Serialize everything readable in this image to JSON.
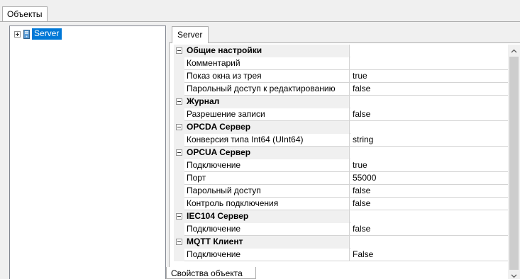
{
  "top_tab": {
    "label": "Объекты"
  },
  "tree": {
    "items": [
      {
        "label": "Server",
        "icon": "server-icon"
      }
    ]
  },
  "inner_tab": {
    "label": "Server"
  },
  "bottom_tab": {
    "label": "Свойства объекта"
  },
  "grid": {
    "rows": [
      {
        "type": "category",
        "name": "Общие настройки",
        "value": ""
      },
      {
        "type": "property",
        "name": "Комментарий",
        "value": ""
      },
      {
        "type": "property",
        "name": "Показ окна из трея",
        "value": "true"
      },
      {
        "type": "property",
        "name": "Парольный доступ к редактированию",
        "value": "false"
      },
      {
        "type": "category",
        "name": "Журнал",
        "value": ""
      },
      {
        "type": "property",
        "name": "Разрешение записи",
        "value": "false"
      },
      {
        "type": "category",
        "name": "OPCDA Сервер",
        "value": ""
      },
      {
        "type": "property",
        "name": "Конверсия типа Int64 (UInt64)",
        "value": "string"
      },
      {
        "type": "category",
        "name": "OPCUA Сервер",
        "value": ""
      },
      {
        "type": "property",
        "name": "Подключение",
        "value": "true"
      },
      {
        "type": "property",
        "name": "Порт",
        "value": "55000"
      },
      {
        "type": "property",
        "name": "Парольный доступ",
        "value": "false"
      },
      {
        "type": "property",
        "name": "Контроль подключения",
        "value": "false"
      },
      {
        "type": "category",
        "name": "IEC104 Сервер",
        "value": ""
      },
      {
        "type": "property",
        "name": "Подключение",
        "value": "false"
      },
      {
        "type": "category",
        "name": "MQTT Клиент",
        "value": ""
      },
      {
        "type": "property",
        "name": "Подключение",
        "value": "False"
      }
    ]
  },
  "colors": {
    "selection": "#0078d7",
    "grid_line": "#d4d4d4",
    "category_bg": "#f0f0f0"
  }
}
